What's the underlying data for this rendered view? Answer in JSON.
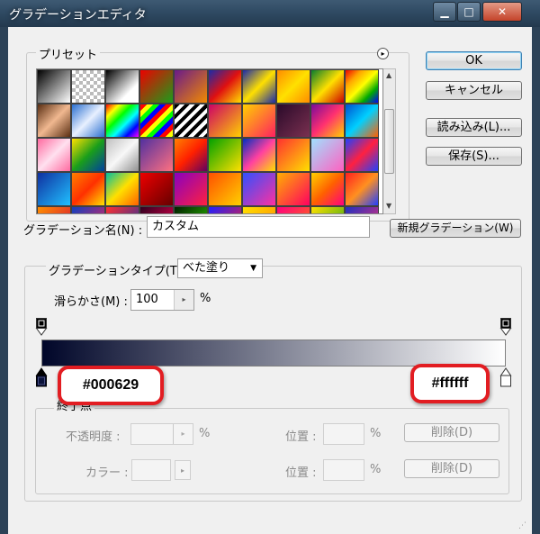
{
  "window": {
    "title": "グラデーションエディタ",
    "min_glyph": "▁",
    "max_glyph": "□",
    "close_glyph": "✕"
  },
  "presets": {
    "label": "プリセット",
    "menu_icon": "▸",
    "swatches": [
      "linear-gradient(135deg,#000 0%,#fff 100%)",
      "repeating-conic-gradient(#bbb 0 25%,#fff 0 50%) 0 0/8px 8px",
      "linear-gradient(135deg,#000 0%,#fff 70%)",
      "linear-gradient(135deg,#e00 0%,#1a9e1a 100%)",
      "linear-gradient(135deg,#6a1a8a 0%,#f28a00 100%)",
      "linear-gradient(135deg,#1b2aa8 0%,#e01010 50%,#ffe000 100%)",
      "linear-gradient(135deg,#1b2aa8 0%,#ffe000 50%,#1b2aa8 100%)",
      "linear-gradient(135deg,#ff8c00 0%,#ffe000 50%,#ff8c00 100%)",
      "linear-gradient(135deg,#0a7d2c 0%,#ffe000 50%,#c00 100%)",
      "linear-gradient(135deg,#e00 0%,#ffa500 25%,#ff0 50%,#0a0 75%,#00f 100%)",
      "linear-gradient(135deg,#5a2e12 0%,#f0b890 50%,#5a2e12 100%)",
      "linear-gradient(135deg,#2a6fd0 0%,#e8f0ff 50%,#2a6fd0 100%)",
      "linear-gradient(135deg,#f00 0%,#ff0 20%,#0f0 40%,#0ff 60%,#00f 80%,#f0f 100%)",
      "repeating-linear-gradient(135deg,#f00 0 5px,#ff0 5px 10px,#0f0 10px 15px,#00f 15px 20px)",
      "repeating-linear-gradient(135deg,#000 0 4px,#fff 4px 8px)",
      "linear-gradient(135deg,#c06 0%,#ffd000 100%)",
      "linear-gradient(135deg,#ffd000 0%,#ff2060 100%)",
      "linear-gradient(135deg,#2a0a2a 0%,#7a3050 100%)",
      "linear-gradient(135deg,#7a0a9a 0%,#ff3070 50%,#ffd000 100%)",
      "linear-gradient(135deg,#0050d0 0%,#00d0ff 50%,#ff6000 100%)",
      "linear-gradient(135deg,#ff6aa0 0%,#ffe0ef 50%,#ff6aa0 100%)",
      "linear-gradient(135deg,#ffe000 0%,#1a9e1a 50%,#0040a0 100%)",
      "linear-gradient(135deg,#c0c0c0 0%,#f8f8f8 50%,#909090 100%)",
      "linear-gradient(135deg,#5030a0 0%,#ff7080 100%)",
      "linear-gradient(135deg,#ff8000 0%,#ff2000 50%,#600060 100%)",
      "linear-gradient(135deg,#00a000 0%,#ffe000 100%)",
      "linear-gradient(135deg,#0030c0 0%,#ff40a0 50%,#ffe000 100%)",
      "linear-gradient(135deg,#ff3030 0%,#ffe000 100%)",
      "linear-gradient(135deg,#a0e0ff 0%,#ff60c0 100%)",
      "linear-gradient(135deg,#2040ff 0%,#ff2040 50%,#2040ff 100%)",
      "linear-gradient(135deg,#1030a0 0%,#20c0ff 100%)",
      "linear-gradient(135deg,#ff8000 0%,#ff3000 50%,#ffe000 100%)",
      "linear-gradient(135deg,#00c0a0 0%,#ffe000 50%,#ff6000 100%)",
      "linear-gradient(135deg,#e00 0%,#600 100%)",
      "linear-gradient(135deg,#8a00c0 0%,#ff2040 100%)",
      "linear-gradient(135deg,#ff5000 0%,#ffd000 100%)",
      "linear-gradient(135deg,#3050ff 0%,#ff30a0 100%)",
      "linear-gradient(135deg,#ffb000 0%,#ff0060 100%)",
      "linear-gradient(135deg,#ffd000 0%,#ff6000 50%,#ff0080 100%)",
      "linear-gradient(135deg,#ff2020 0%,#ff9020 50%,#2040ff 100%)",
      "linear-gradient(135deg,#ff9000 0%,#d00040 100%)",
      "linear-gradient(135deg,#1040c0 0%,#ff2050 100%)",
      "linear-gradient(135deg,#ff3030 0%,#0030b0 100%)",
      "linear-gradient(135deg,#300020 0%,#ff0050 100%)",
      "linear-gradient(135deg,#002000 0%,#30d000 100%)",
      "linear-gradient(135deg,#2020ff 0%,#ff2020 100%)",
      "linear-gradient(135deg,#ffe000 0%,#ff8000 100%)",
      "linear-gradient(135deg,#ff0080 0%,#ff8000 100%)",
      "linear-gradient(135deg,#ffe000 0%,#1a9e1a 100%)",
      "linear-gradient(135deg,#2030c0 0%,#ff3070 100%)"
    ]
  },
  "buttons": {
    "ok": "OK",
    "cancel": "キャンセル",
    "load": "読み込み(L)...",
    "save": "保存(S)...",
    "new_gradient": "新規グラデーション(W)"
  },
  "name_field": {
    "label": "グラデーション名(N) :",
    "value": "カスタム"
  },
  "gradient_type": {
    "label": "グラデーションタイプ(T) :",
    "value": "べた塗り"
  },
  "smoothness": {
    "label": "滑らかさ(M) :",
    "value": "100",
    "unit": "%"
  },
  "gradient": {
    "start_color": "#000629",
    "end_color": "#ffffff",
    "start_callout": "#000629",
    "end_callout": "#ffffff"
  },
  "color_stops": {
    "label": "終了点",
    "opacity_label": "不透明度 :",
    "opacity_unit": "%",
    "opacity_position_label": "位置 :",
    "opacity_position_unit": "%",
    "opacity_delete": "削除(D)",
    "color_label": "カラー :",
    "color_position_label": "位置 :",
    "color_position_unit": "%",
    "color_delete": "削除(D)"
  },
  "icons": {
    "dropdown": "▼",
    "spin": "▸",
    "scroll_up": "▲",
    "scroll_down": "▼",
    "grip": "⋰"
  }
}
